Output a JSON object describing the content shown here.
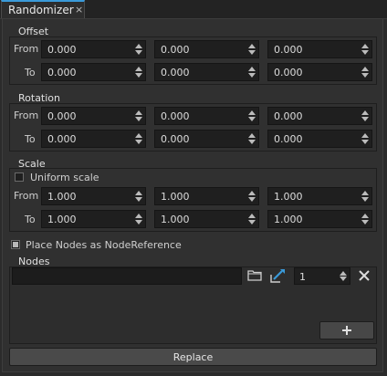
{
  "tab": {
    "title": "Randomizer",
    "close": "×"
  },
  "offset": {
    "title": "Offset",
    "from_label": "From",
    "to_label": "To",
    "from": [
      "0.000",
      "0.000",
      "0.000"
    ],
    "to": [
      "0.000",
      "0.000",
      "0.000"
    ]
  },
  "rotation": {
    "title": "Rotation",
    "from_label": "From",
    "to_label": "To",
    "from": [
      "0.000",
      "0.000",
      "0.000"
    ],
    "to": [
      "0.000",
      "0.000",
      "0.000"
    ]
  },
  "scale": {
    "title": "Scale",
    "uniform_label": "Uniform scale",
    "uniform_checked": false,
    "from_label": "From",
    "to_label": "To",
    "from": [
      "1.000",
      "1.000",
      "1.000"
    ],
    "to": [
      "1.000",
      "1.000",
      "1.000"
    ]
  },
  "place_nodes": {
    "label": "Place Nodes as NodeReference",
    "checked": true
  },
  "nodes": {
    "title": "Nodes",
    "path_value": "",
    "count": "1"
  },
  "replace_label": "Replace",
  "icons": {
    "folder": "folder-icon",
    "pick": "pick-node-icon",
    "remove": "remove-icon",
    "add": "plus-icon"
  }
}
